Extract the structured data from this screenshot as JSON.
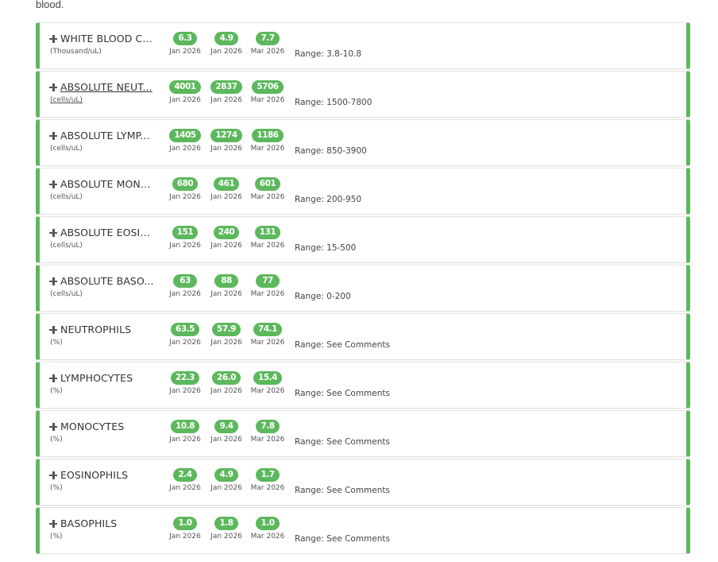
{
  "intro_text": "blood.",
  "accent_color": "#5cb85c",
  "tests": [
    {
      "name": "WHITE BLOOD CE...",
      "unit": "(Thousand/uL)",
      "range": "Range: 3.8-10.8",
      "results": [
        {
          "value": "6.3",
          "date": "Jan 2026"
        },
        {
          "value": "4.9",
          "date": "Jan 2026"
        },
        {
          "value": "7.7",
          "date": "Mar 2026"
        }
      ]
    },
    {
      "name": "ABSOLUTE NEUT...",
      "unit": "(cells/uL)",
      "range": "Range: 1500-7800",
      "results": [
        {
          "value": "4001",
          "date": "Jan 2026"
        },
        {
          "value": "2837",
          "date": "Jan 2026"
        },
        {
          "value": "5706",
          "date": "Mar 2026"
        }
      ]
    },
    {
      "name": "ABSOLUTE LYMP...",
      "unit": "(cells/uL)",
      "range": "Range: 850-3900",
      "results": [
        {
          "value": "1405",
          "date": "Jan 2026"
        },
        {
          "value": "1274",
          "date": "Jan 2026"
        },
        {
          "value": "1186",
          "date": "Mar 2026"
        }
      ]
    },
    {
      "name": "ABSOLUTE MONO...",
      "unit": "(cells/uL)",
      "range": "Range: 200-950",
      "results": [
        {
          "value": "680",
          "date": "Jan 2026"
        },
        {
          "value": "461",
          "date": "Jan 2026"
        },
        {
          "value": "601",
          "date": "Mar 2026"
        }
      ]
    },
    {
      "name": "ABSOLUTE EOSIN...",
      "unit": "(cells/uL)",
      "range": "Range: 15-500",
      "results": [
        {
          "value": "151",
          "date": "Jan 2026"
        },
        {
          "value": "240",
          "date": "Jan 2026"
        },
        {
          "value": "131",
          "date": "Mar 2026"
        }
      ]
    },
    {
      "name": "ABSOLUTE BASO...",
      "unit": "(cells/uL)",
      "range": "Range: 0-200",
      "results": [
        {
          "value": "63",
          "date": "Jan 2026"
        },
        {
          "value": "88",
          "date": "Jan 2026"
        },
        {
          "value": "77",
          "date": "Mar 2026"
        }
      ]
    },
    {
      "name": "NEUTROPHILS",
      "unit": "(%)",
      "range": "Range: See Comments",
      "results": [
        {
          "value": "63.5",
          "date": "Jan 2026"
        },
        {
          "value": "57.9",
          "date": "Jan 2026"
        },
        {
          "value": "74.1",
          "date": "Mar 2026"
        }
      ]
    },
    {
      "name": "LYMPHOCYTES",
      "unit": "(%)",
      "range": "Range: See Comments",
      "results": [
        {
          "value": "22.3",
          "date": "Jan 2026"
        },
        {
          "value": "26.0",
          "date": "Jan 2026"
        },
        {
          "value": "15.4",
          "date": "Mar 2026"
        }
      ]
    },
    {
      "name": "MONOCYTES",
      "unit": "(%)",
      "range": "Range: See Comments",
      "results": [
        {
          "value": "10.8",
          "date": "Jan 2026"
        },
        {
          "value": "9.4",
          "date": "Jan 2026"
        },
        {
          "value": "7.8",
          "date": "Mar 2026"
        }
      ]
    },
    {
      "name": "EOSINOPHILS",
      "unit": "(%)",
      "range": "Range: See Comments",
      "results": [
        {
          "value": "2.4",
          "date": "Jan 2026"
        },
        {
          "value": "4.9",
          "date": "Jan 2026"
        },
        {
          "value": "1.7",
          "date": "Mar 2026"
        }
      ]
    },
    {
      "name": "BASOPHILS",
      "unit": "(%)",
      "range": "Range: See Comments",
      "results": [
        {
          "value": "1.0",
          "date": "Jan 2026"
        },
        {
          "value": "1.8",
          "date": "Jan 2026"
        },
        {
          "value": "1.0",
          "date": "Mar 2026"
        }
      ]
    }
  ]
}
